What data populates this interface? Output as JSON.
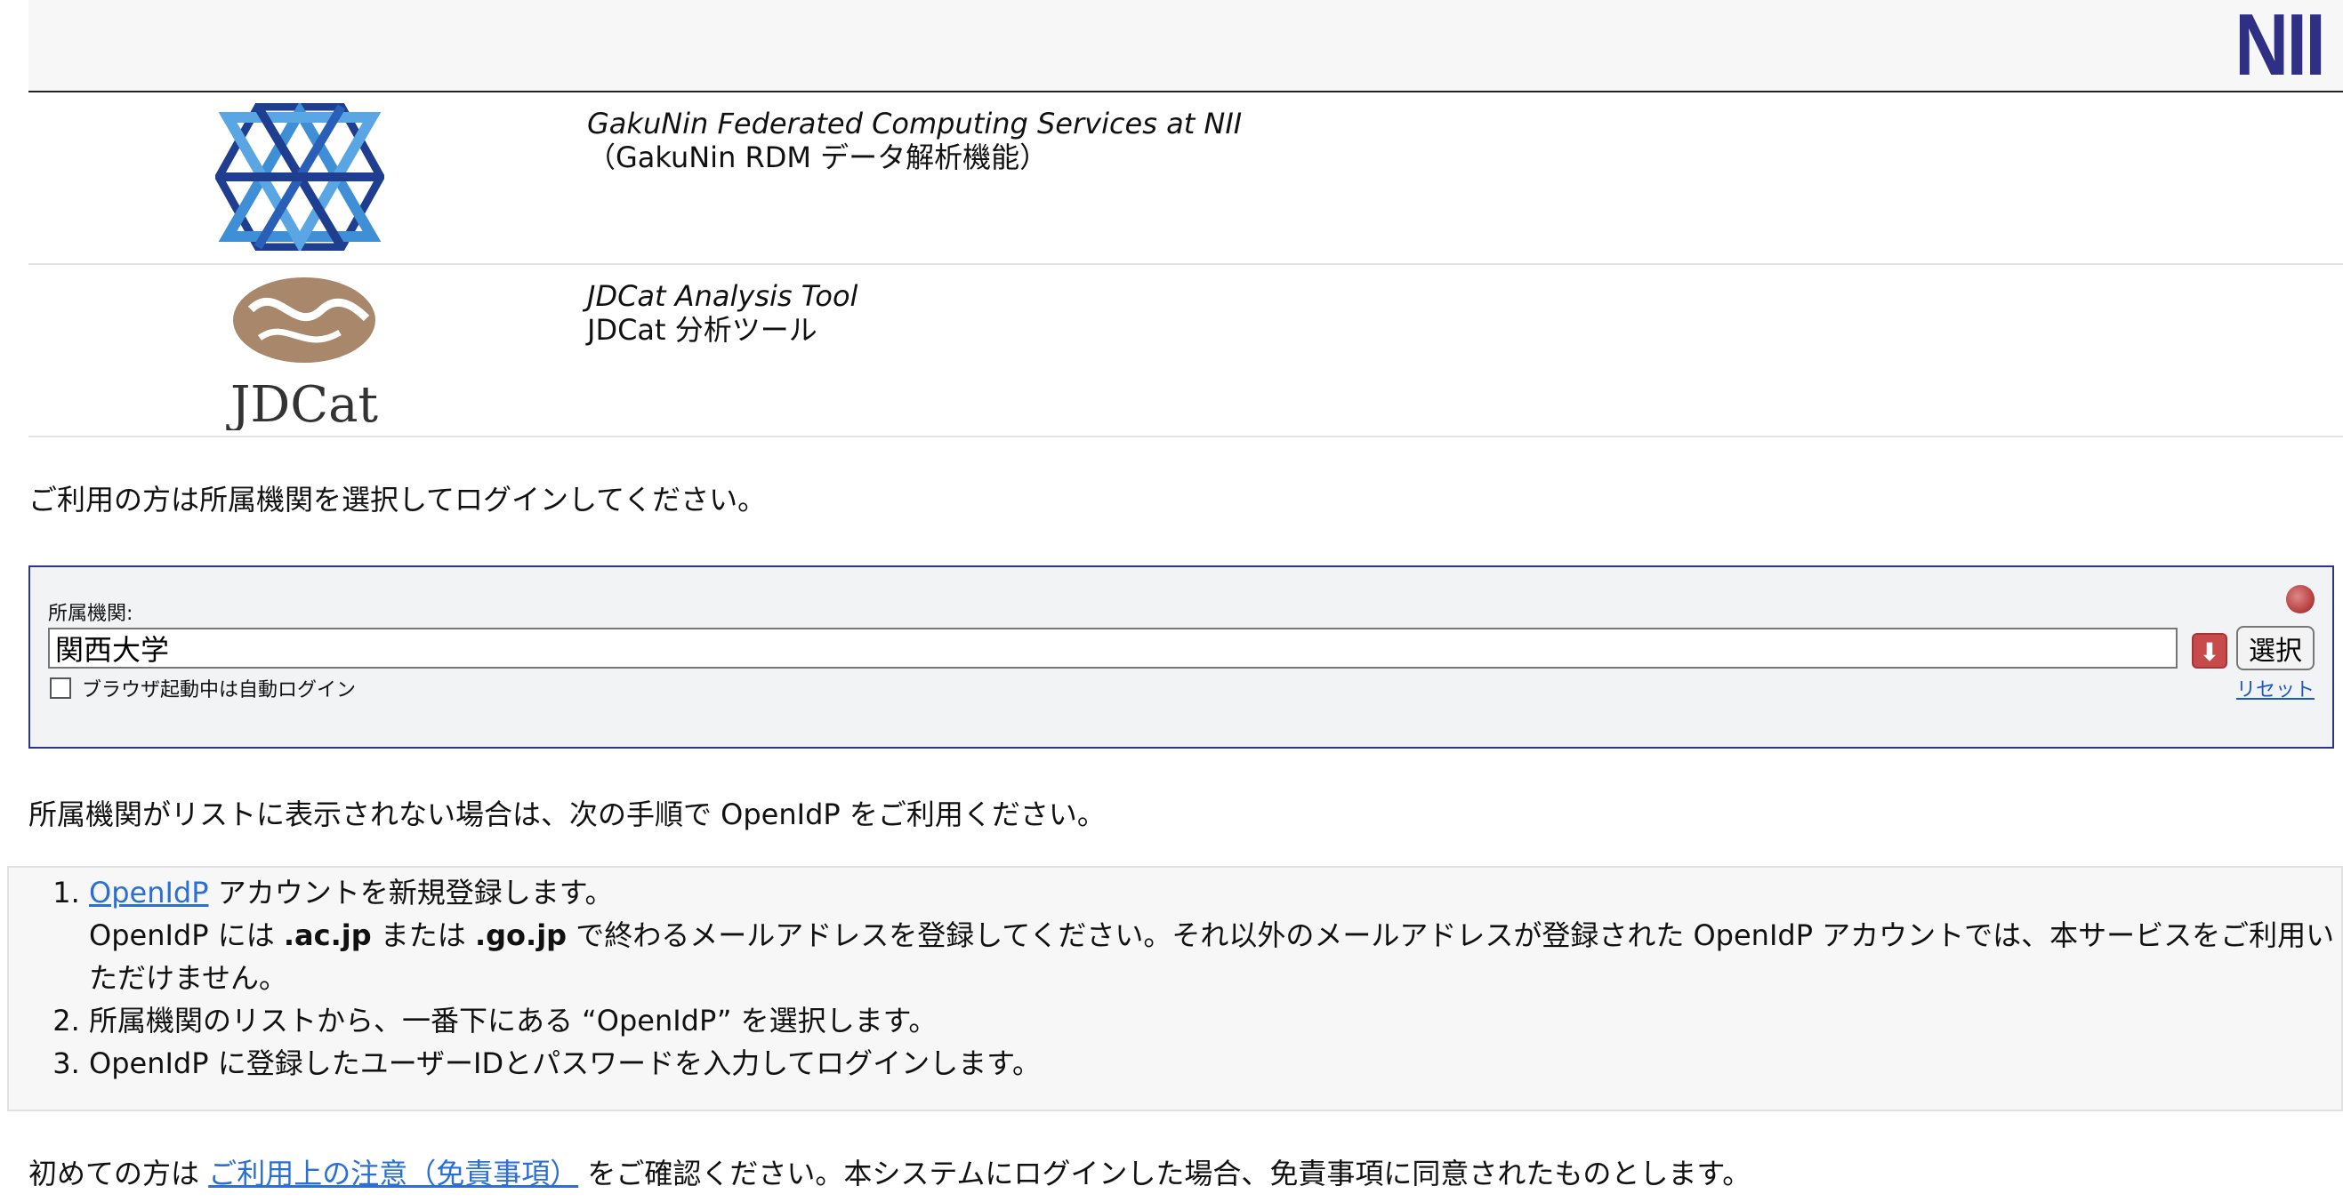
{
  "header": {
    "logo_text": "NII"
  },
  "services": [
    {
      "name_en": "GakuNin Federated Computing Services at NII",
      "name_ja": "（GakuNin RDM データ解析機能）"
    },
    {
      "name_en": "JDCat Analysis Tool",
      "name_ja": "JDCat 分析ツール",
      "logo_text": "JDCat"
    }
  ],
  "intro_text": "ご利用の方は所属機関を選択してログインしてください。",
  "wayf": {
    "label": "所属機関:",
    "selected_value": "関西大学",
    "select_button": "選択",
    "auto_login_label": "ブラウザ起動中は自動ログイン",
    "auto_login_checked": false,
    "reset_link": "リセット"
  },
  "openidp_note": "所属機関がリストに表示されない場合は、次の手順で OpenIdP をご利用ください。",
  "steps": {
    "step1_link": "OpenIdP",
    "step1_text": " アカウントを新規登録します。",
    "step1_detail_a": "OpenIdP には ",
    "step1_detail_b": ".ac.jp",
    "step1_detail_c": " または ",
    "step1_detail_d": ".go.jp",
    "step1_detail_e": " で終わるメールアドレスを登録してください。それ以外のメールアドレスが登録された OpenIdP アカウントでは、本サービスをご利用いただけません。",
    "step2": "所属機関のリストから、一番下にある “OpenIdP” を選択します。",
    "step3": "OpenIdP に登録したユーザーIDとパスワードを入力してログインします。"
  },
  "footer": {
    "prefix": "初めての方は ",
    "link": "ご利用上の注意（免責事項）",
    "suffix": " をご確認ください。本システムにログインした場合、免責事項に同意されたものとします。"
  },
  "colors": {
    "accent": "#2a3585",
    "link": "#2a6fd6",
    "nii": "#2f2f86"
  }
}
